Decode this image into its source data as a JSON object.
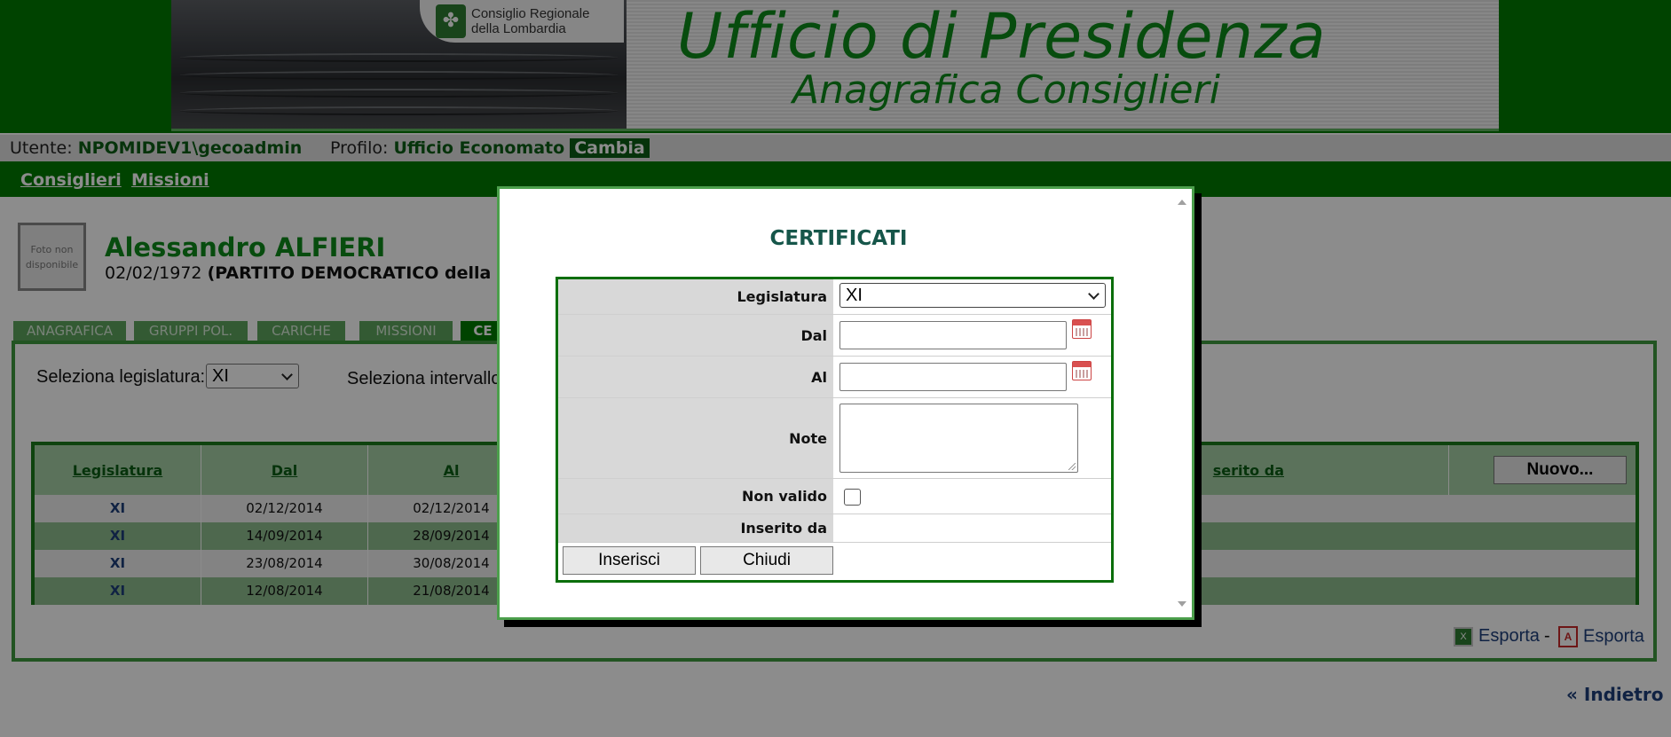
{
  "banner": {
    "logo_text_line1": "Consiglio Regionale",
    "logo_text_line2": "della Lombardia",
    "title": "Ufficio di Presidenza",
    "subtitle": "Anagrafica Consiglieri"
  },
  "userbar": {
    "user_label": "Utente:",
    "user_value": "NPOMIDEV1\\gecoadmin",
    "profile_label": "Profilo:",
    "profile_value": "Ufficio Economato",
    "change_label": "Cambia"
  },
  "nav": {
    "items": [
      "Consiglieri",
      "Missioni"
    ]
  },
  "person": {
    "photo_placeholder": "Foto non disponibile",
    "name": "Alessandro ALFIERI",
    "birthdate": "02/02/1972",
    "party": "(PARTITO DEMOCRATICO della LO"
  },
  "tabs": [
    "ANAGRAFICA",
    "GRUPPI POL.",
    "CARICHE",
    "MISSIONI",
    "CE"
  ],
  "filters": {
    "legislatura_label": "Seleziona legislatura:",
    "legislatura_value": "XI",
    "range_label": "Seleziona intervallo"
  },
  "table": {
    "headers": [
      "Legislatura",
      "Dal",
      "Al",
      "serito da"
    ],
    "new_button": "Nuovo...",
    "rows": [
      {
        "legislatura": "XI",
        "dal": "02/12/2014",
        "al": "02/12/2014"
      },
      {
        "legislatura": "XI",
        "dal": "14/09/2014",
        "al": "28/09/2014"
      },
      {
        "legislatura": "XI",
        "dal": "23/08/2014",
        "al": "30/08/2014"
      },
      {
        "legislatura": "XI",
        "dal": "12/08/2014",
        "al": "21/08/2014"
      }
    ]
  },
  "export": {
    "excel_label": "Esporta",
    "separator": "-",
    "pdf_label": "Esporta",
    "excel_icon": "excel-icon",
    "pdf_icon": "pdf-icon"
  },
  "back_link": "« Indietro",
  "modal": {
    "title": "CERTIFICATI",
    "fields": {
      "legislatura_label": "Legislatura",
      "legislatura_value": "XI",
      "dal_label": "Dal",
      "dal_value": "",
      "al_label": "Al",
      "al_value": "",
      "note_label": "Note",
      "note_value": "",
      "non_valido_label": "Non valido",
      "non_valido_checked": false,
      "inserito_da_label": "Inserito da",
      "inserito_da_value": ""
    },
    "insert_button": "Inserisci",
    "close_button": "Chiudi",
    "calendar_icon": "calendar-icon"
  },
  "colors": {
    "brand_green": "#007a00",
    "title_green": "#0e8a1a",
    "link_blue": "#1e3f7a",
    "modal_title": "#16564a"
  }
}
